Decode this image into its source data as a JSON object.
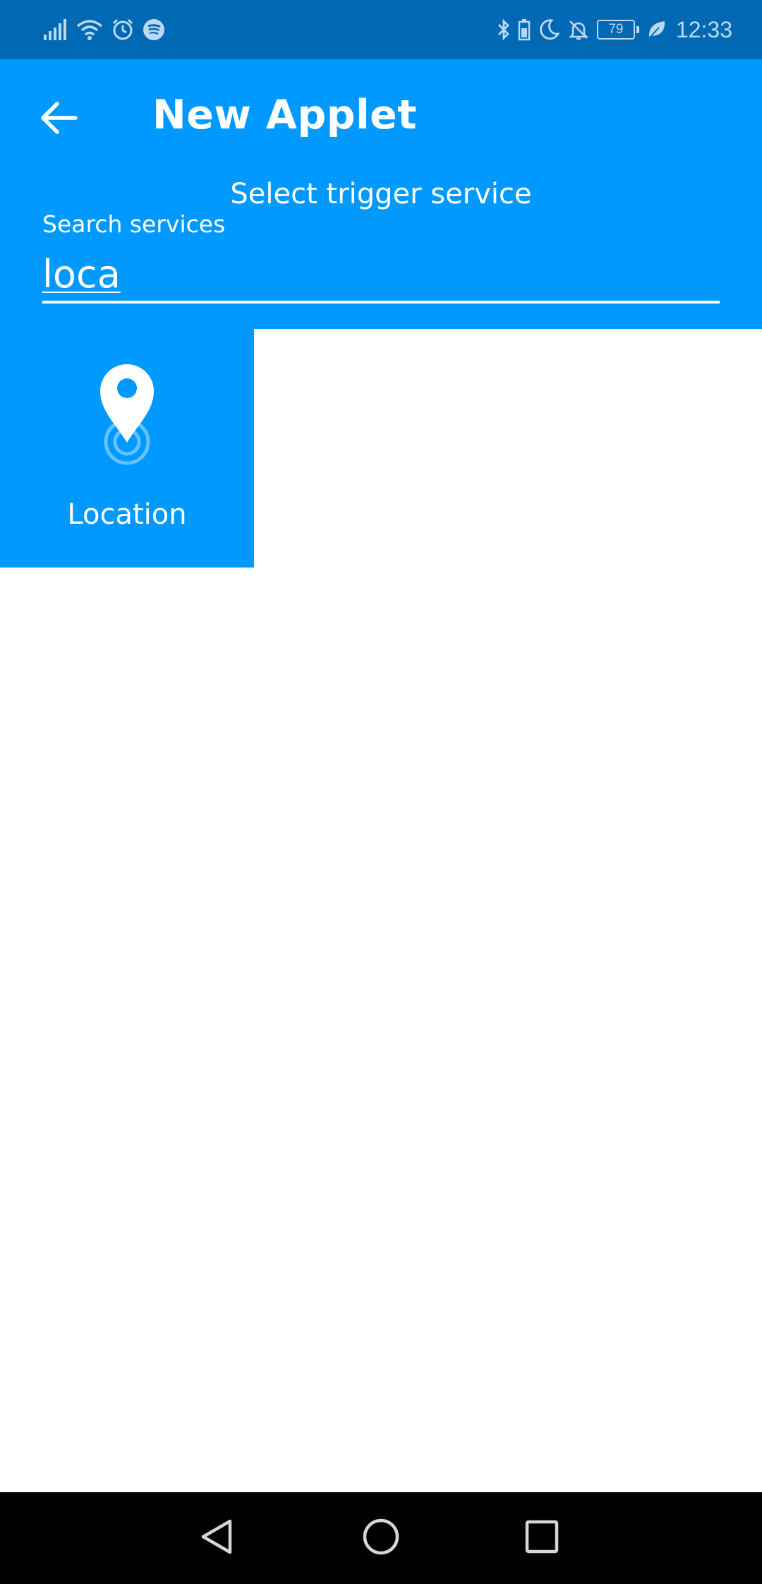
{
  "status_bar": {
    "battery_level": "79",
    "time": "12:33",
    "icons_left": [
      "signal-icon",
      "wifi-icon",
      "alarm-icon",
      "spotify-icon"
    ],
    "icons_right": [
      "bluetooth-icon",
      "battery-saver-icon",
      "moon-icon",
      "bell-off-icon",
      "battery-icon",
      "leaf-icon"
    ]
  },
  "header": {
    "title": "New Applet",
    "subtitle": "Select trigger service",
    "back_icon": "arrow-left-icon"
  },
  "search": {
    "label": "Search services",
    "value": "loca"
  },
  "results": [
    {
      "label": "Location",
      "icon": "location-pin-icon"
    }
  ],
  "nav": {
    "icons": [
      "back-triangle-icon",
      "home-circle-icon",
      "recents-square-icon"
    ]
  },
  "colors": {
    "status_bar": "#0168b4",
    "primary": "#0099ff",
    "nav_bar": "#000000",
    "text_on_primary": "#ffffff"
  }
}
